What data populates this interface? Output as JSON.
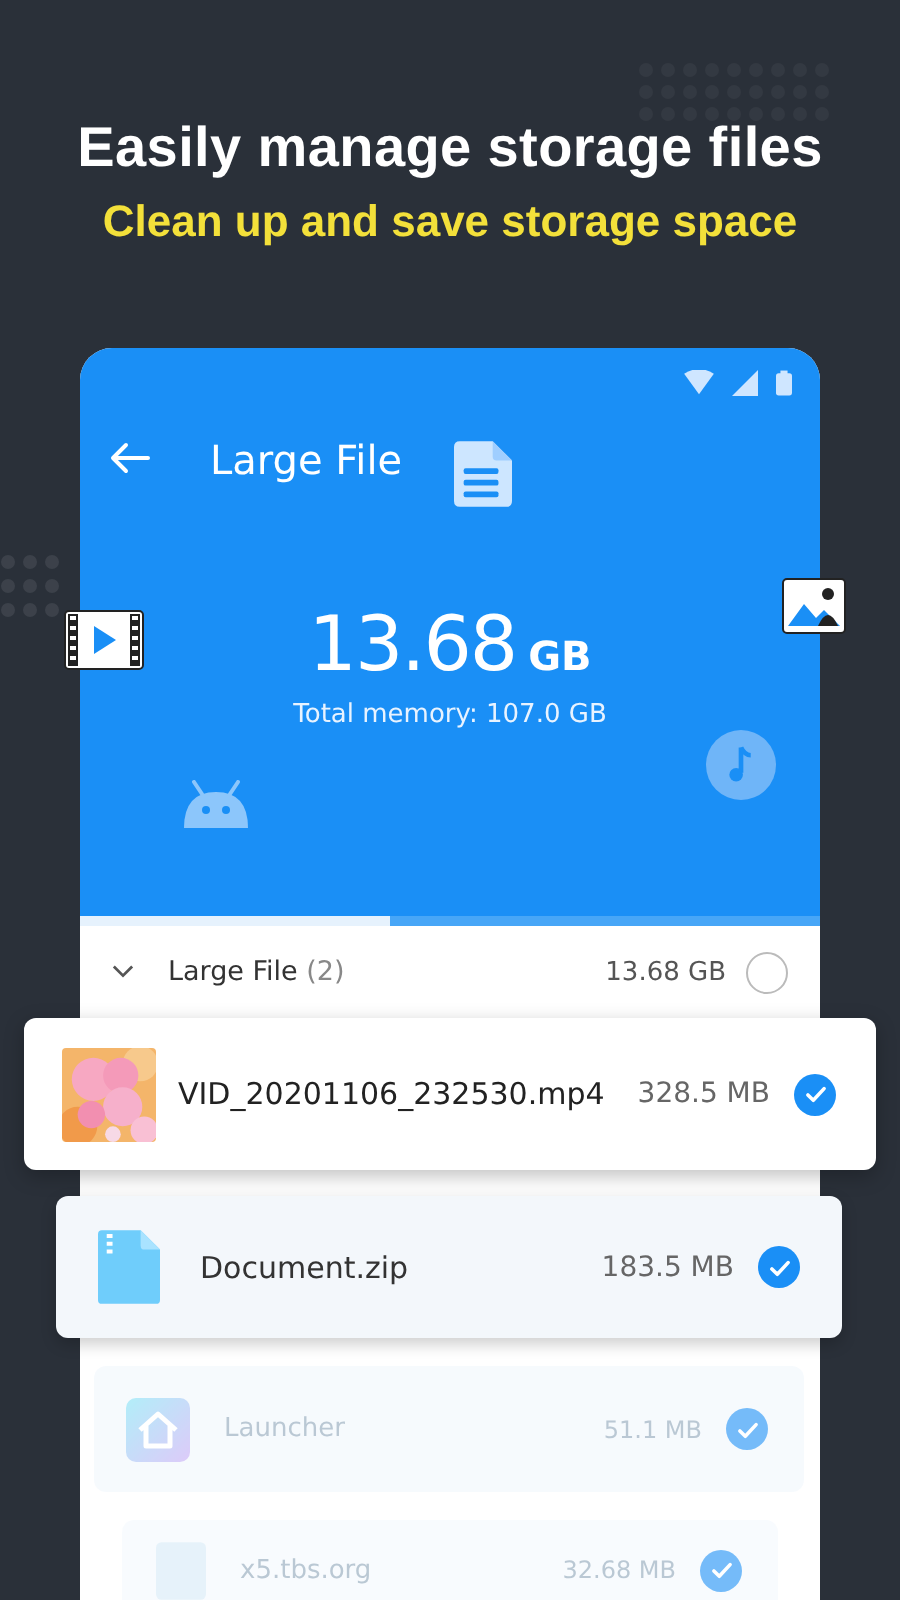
{
  "headline": "Easily manage storage files",
  "subheadline": "Clean up and save storage space",
  "app": {
    "title": "Large File",
    "size": "13.68",
    "unit": "GB",
    "total": "Total memory: 107.0 GB",
    "level": 0.42
  },
  "group": {
    "label": "Large File",
    "count": "(2)",
    "size": "13.68 GB",
    "expanded": true,
    "checked": false
  },
  "files": [
    {
      "kind": "video",
      "name": "VID_20201106_232530.mp4",
      "size": "328.5 MB",
      "checked": true
    },
    {
      "kind": "zip",
      "name": "Document.zip",
      "size": "183.5 MB",
      "checked": true
    },
    {
      "kind": "app",
      "name": "Launcher",
      "size": "51.1 MB",
      "checked": true
    },
    {
      "kind": "web",
      "name": "x5.tbs.org",
      "size": "32.68 MB",
      "checked": true
    }
  ]
}
